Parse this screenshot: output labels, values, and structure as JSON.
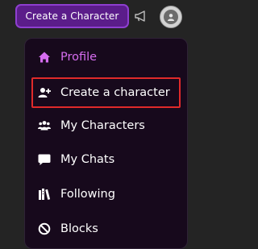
{
  "topbar": {
    "create_button_label": "Create a Character",
    "icons": {
      "announcement": "megaphone-icon",
      "account": "user-avatar-icon"
    }
  },
  "menu": {
    "items": [
      {
        "label": "Profile",
        "icon": "home-icon",
        "active": true
      },
      {
        "label": "Create a character",
        "icon": "user-plus-icon",
        "highlighted": true
      },
      {
        "label": "My Characters",
        "icon": "users-icon"
      },
      {
        "label": "My Chats",
        "icon": "chat-bubble-icon"
      },
      {
        "label": "Following",
        "icon": "library-icon"
      },
      {
        "label": "Blocks",
        "icon": "ban-icon"
      }
    ]
  },
  "colors": {
    "background": "#242424",
    "menu_background": "#17091c",
    "accent": "#d66df0",
    "button_background": "#5b1d8a",
    "highlight_border": "#e02a2a"
  }
}
